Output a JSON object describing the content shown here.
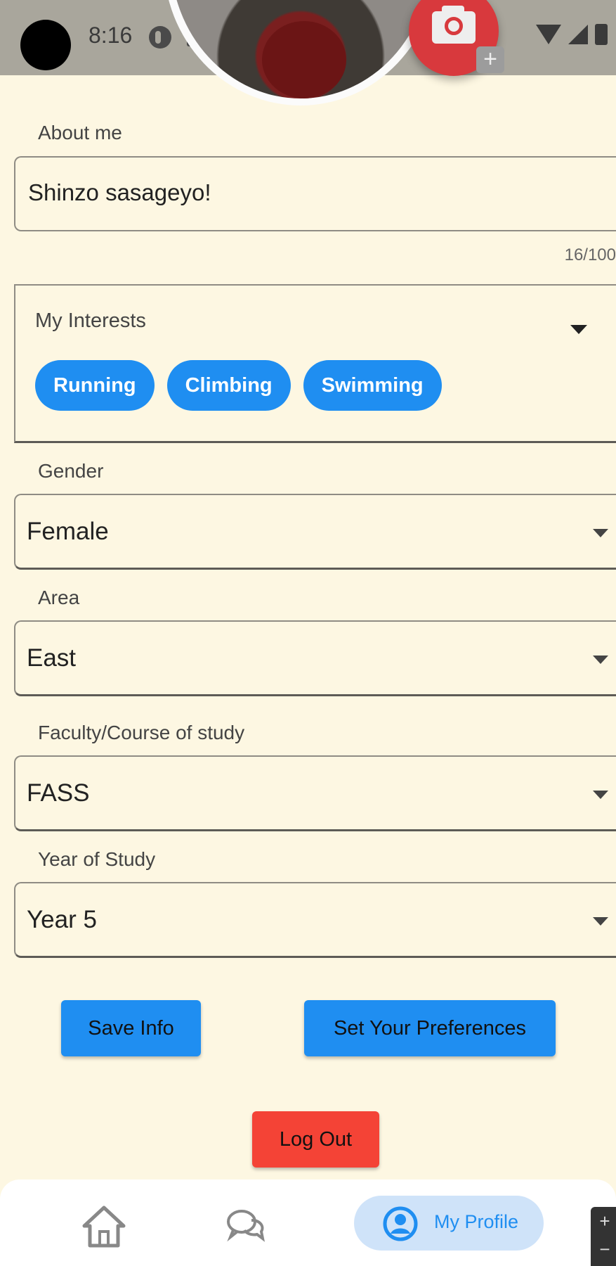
{
  "status_bar": {
    "time": "8:16"
  },
  "about": {
    "label": "About me",
    "value": "Shinzo sasageyo!",
    "counter": "16/100"
  },
  "interests": {
    "label": "My Interests",
    "chips": [
      "Running",
      "Climbing",
      "Swimming"
    ]
  },
  "gender": {
    "label": "Gender",
    "value": "Female"
  },
  "area": {
    "label": "Area",
    "value": "East"
  },
  "faculty": {
    "label": "Faculty/Course of study",
    "value": "FASS"
  },
  "year": {
    "label": "Year of Study",
    "value": "Year 5"
  },
  "buttons": {
    "save": "Save Info",
    "preferences": "Set Your Preferences",
    "logout": "Log Out"
  },
  "nav": {
    "home_icon": "home-icon",
    "chat_icon": "chat-icon",
    "profile_label": "My Profile"
  },
  "zoom": {
    "plus": "+",
    "minus": "−"
  },
  "colors": {
    "background": "#fdf7e2",
    "accent_blue": "#1f8ef1",
    "logout_red": "#f44336",
    "camera_red": "#d8393d",
    "profile_pill": "#cfe3f9"
  }
}
